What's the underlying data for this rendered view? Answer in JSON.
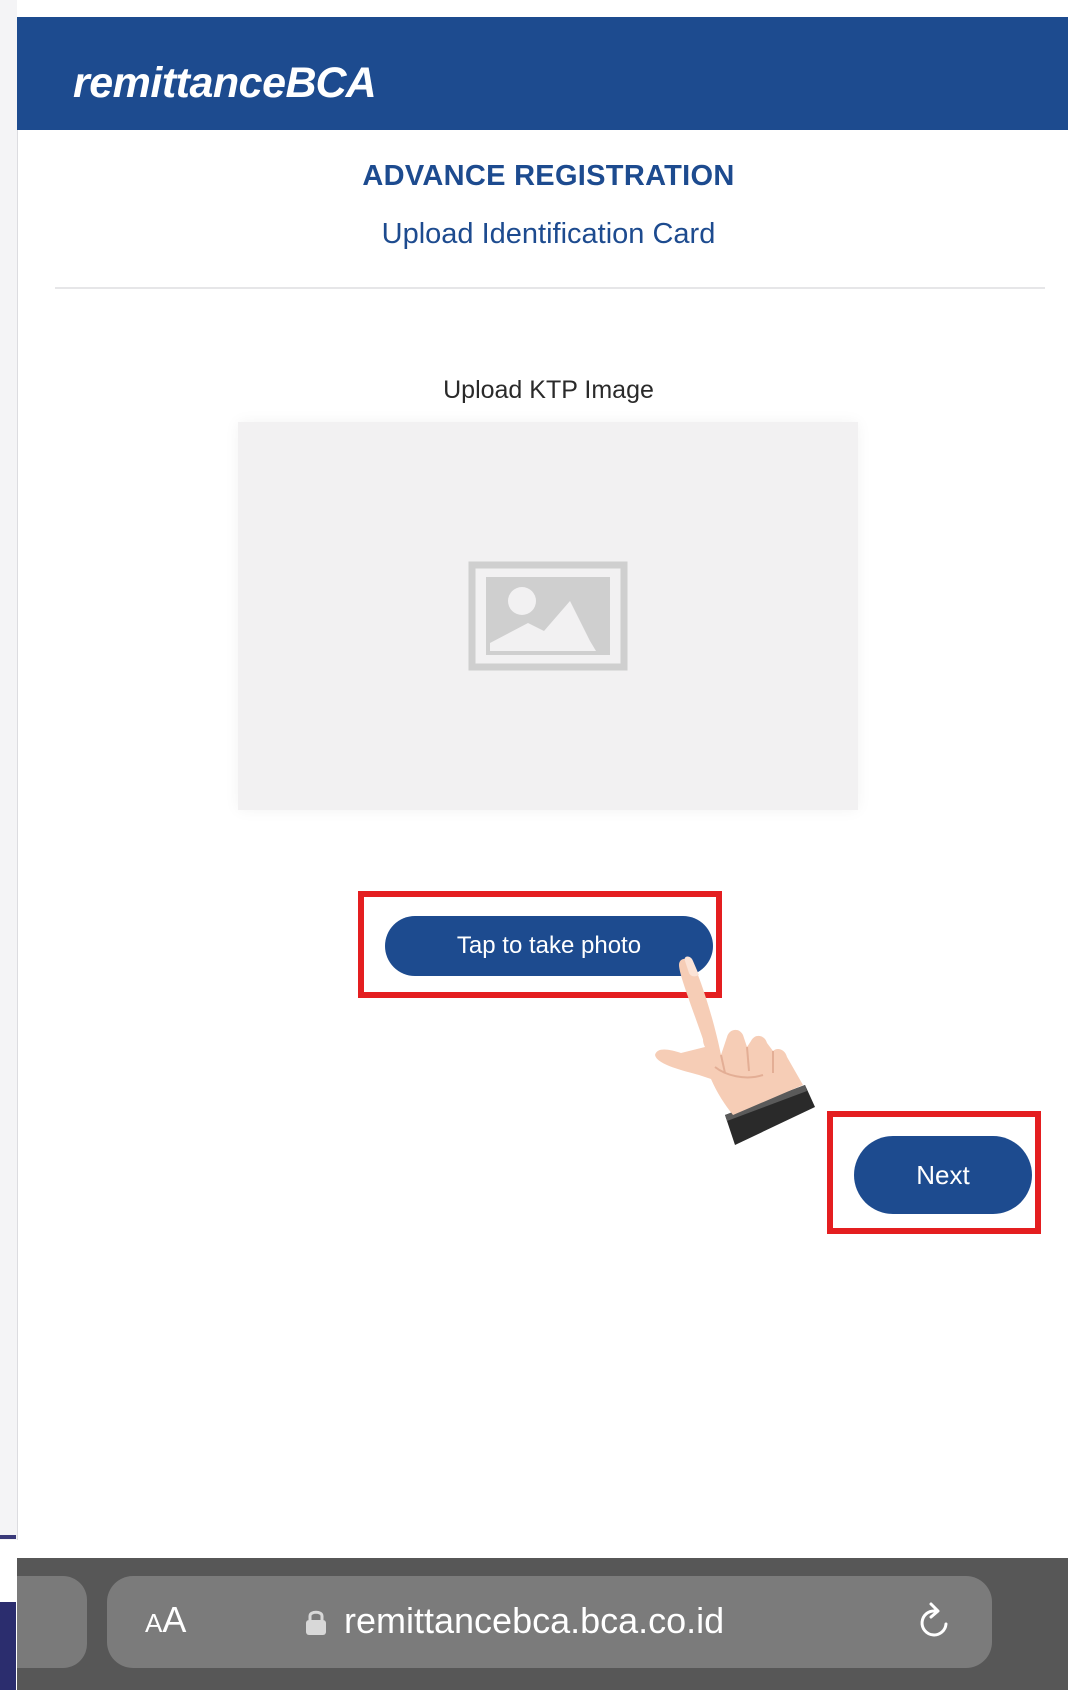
{
  "header": {
    "brand_prefix": "remittance",
    "brand_suffix": "BCA"
  },
  "page": {
    "title": "ADVANCE REGISTRATION",
    "subtitle": "Upload Identification Card"
  },
  "upload": {
    "label": "Upload KTP Image",
    "placeholder_icon": "image-placeholder-icon"
  },
  "actions": {
    "take_photo_label": "Tap to take photo",
    "next_label": "Next"
  },
  "browser": {
    "text_size_label_small": "A",
    "text_size_label_large": "A",
    "url": "remittancebca.bca.co.id",
    "lock_icon": "lock-icon",
    "reload_icon": "reload-icon"
  },
  "colors": {
    "brand_blue": "#1d4b8f",
    "highlight_red": "#e41e20",
    "browser_bar": "#575757"
  }
}
